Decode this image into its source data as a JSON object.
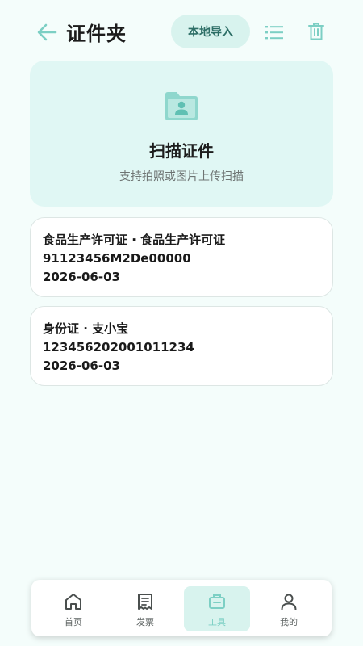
{
  "header": {
    "title": "证件夹",
    "import_label": "本地导入",
    "back_icon": "arrow-left-icon",
    "list_icon": "list-icon",
    "trash_icon": "trash-icon"
  },
  "scan": {
    "title": "扫描证件",
    "subtitle": "支持拍照或图片上传扫描",
    "icon": "folder-id-icon"
  },
  "documents": [
    {
      "name": "食品生产许可证 · 食品生产许可证",
      "number": "91123456M2De00000",
      "date": "2026-06-03"
    },
    {
      "name": "身份证 · 支小宝",
      "number": "123456202001011234",
      "date": "2026-06-03"
    }
  ],
  "nav": {
    "items": [
      {
        "label": "首页",
        "icon": "home-icon"
      },
      {
        "label": "发票",
        "icon": "invoice-icon"
      },
      {
        "label": "工具",
        "icon": "toolbox-icon",
        "active": true
      },
      {
        "label": "我的",
        "icon": "user-icon"
      }
    ]
  },
  "colors": {
    "accent": "#7ccfc4",
    "accent_bg": "#d8f3ee",
    "page_bg": "#f4fdfb",
    "card_bg": "#e0f7f4"
  }
}
